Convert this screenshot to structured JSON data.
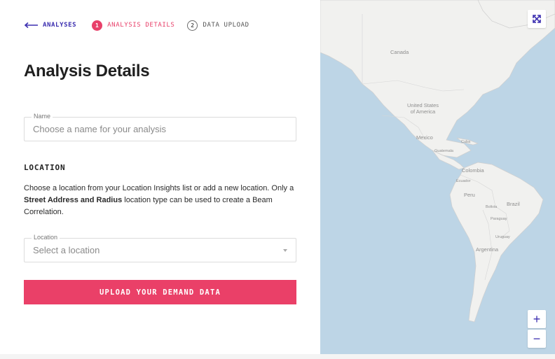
{
  "stepper": {
    "back_label": "ANALYSES",
    "step1_number": "1",
    "step1_label": "ANALYSIS DETAILS",
    "step2_number": "2",
    "step2_label": "DATA UPLOAD"
  },
  "page_title": "Analysis Details",
  "name_field": {
    "legend": "Name",
    "placeholder": "Choose a name for your analysis",
    "value": ""
  },
  "location_section": {
    "heading": "LOCATION",
    "desc_part1": "Choose a location from your Location Insights list or add a new location. Only a ",
    "desc_bold": "Street Address and Radius",
    "desc_part2": " location type can be used to create a Beam Correlation."
  },
  "location_field": {
    "legend": "Location",
    "selected": "Select a location"
  },
  "upload_button": "UPLOAD YOUR DEMAND DATA",
  "map": {
    "labels": {
      "canada": "Canada",
      "usa": "United States\nof America",
      "mexico": "Mexico",
      "cuba": "Cuba",
      "guatemala": "Guatemala",
      "colombia": "Colombia",
      "ecuador": "Ecuador",
      "peru": "Peru",
      "brazil": "Brazil",
      "bolivia": "Bolivia",
      "paraguay": "Paraguay",
      "uruguay": "Uruguay",
      "argentina": "Argentina"
    },
    "zoom_in": "+",
    "zoom_out": "−"
  },
  "colors": {
    "accent": "#ea4068",
    "primary": "#3c2fb0",
    "water": "#bdd5e6",
    "land": "#f1f1ef"
  }
}
